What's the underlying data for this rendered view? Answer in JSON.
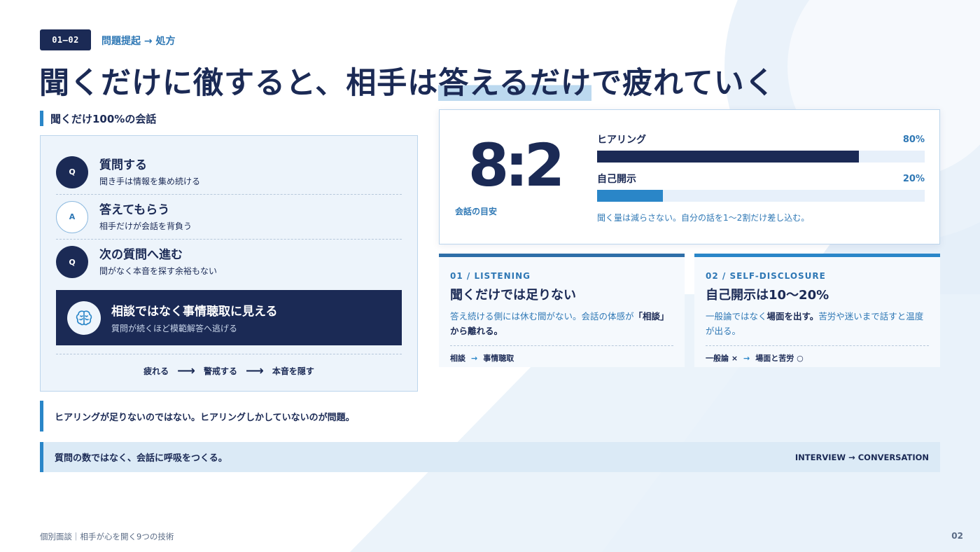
{
  "header": {
    "chip": "01—02",
    "crumb": "問題提起 → 処方",
    "title_before": "聞くだけに徹すると、相手は",
    "title_highlight": "答えるだけ",
    "title_after": "で疲れていく"
  },
  "left_section": {
    "label": "聞くだけ100%の会話",
    "rows": [
      {
        "badge": "Q",
        "title": "質問する",
        "sub": "聞き手は情報を集め続ける"
      },
      {
        "badge": "A",
        "title": "答えてもらう",
        "sub": "相手だけが会話を背負う"
      },
      {
        "badge": "Q",
        "title": "次の質問へ進む",
        "sub": "間がなく本音を探す余裕もない"
      }
    ],
    "callout": {
      "icon": "brain-icon",
      "title": "相談ではなく事情聴取に見える",
      "sub": "質問が続くほど模範解答へ逃げる"
    },
    "flow": [
      "疲れる",
      "警戒する",
      "本音を隠す"
    ]
  },
  "ratio": {
    "big": "8:2",
    "caption": "会話の目安",
    "bars": [
      {
        "name": "ヒアリング",
        "pct_label": "80%",
        "fraction": 0.8,
        "color": "#1b2a55"
      },
      {
        "name": "自己開示",
        "pct_label": "20%",
        "fraction": 0.2,
        "color": "#2a86c8"
      }
    ],
    "note": "聞く量は減らさない。自分の話を1〜2割だけ差し込む。"
  },
  "cards": [
    {
      "label": "01 / LISTENING",
      "title": "聞くだけでは足りない",
      "desc_a": "答え続ける側には休む間がない。会話の体感が",
      "desc_b": "「相談」から離れる。",
      "desc_c": "",
      "foot_a": "相談",
      "foot_arrow": "→",
      "foot_b": "事情聴取",
      "top_color": "#2f6fa8"
    },
    {
      "label": "02 / SELF-DISCLOSURE",
      "title": "自己開示は10〜20%",
      "desc_a": "一般論ではなく",
      "desc_b": "場面を出す。",
      "desc_c": "苦労や迷いまで話すと温度が出る。",
      "foot_a": "一般論 ×",
      "foot_arrow": "→",
      "foot_b": "場面と苦労 ○",
      "top_color": "#2a86c8"
    }
  ],
  "notes": {
    "line1": "ヒアリングが足りないのではない。ヒアリングしかしていないのが問題。",
    "line2": "質問の数ではなく、会話に呼吸をつくる。",
    "tag": "INTERVIEW → CONVERSATION"
  },
  "footer": {
    "text": "個別面談｜相手が心を開く9つの技術",
    "page": "02"
  }
}
